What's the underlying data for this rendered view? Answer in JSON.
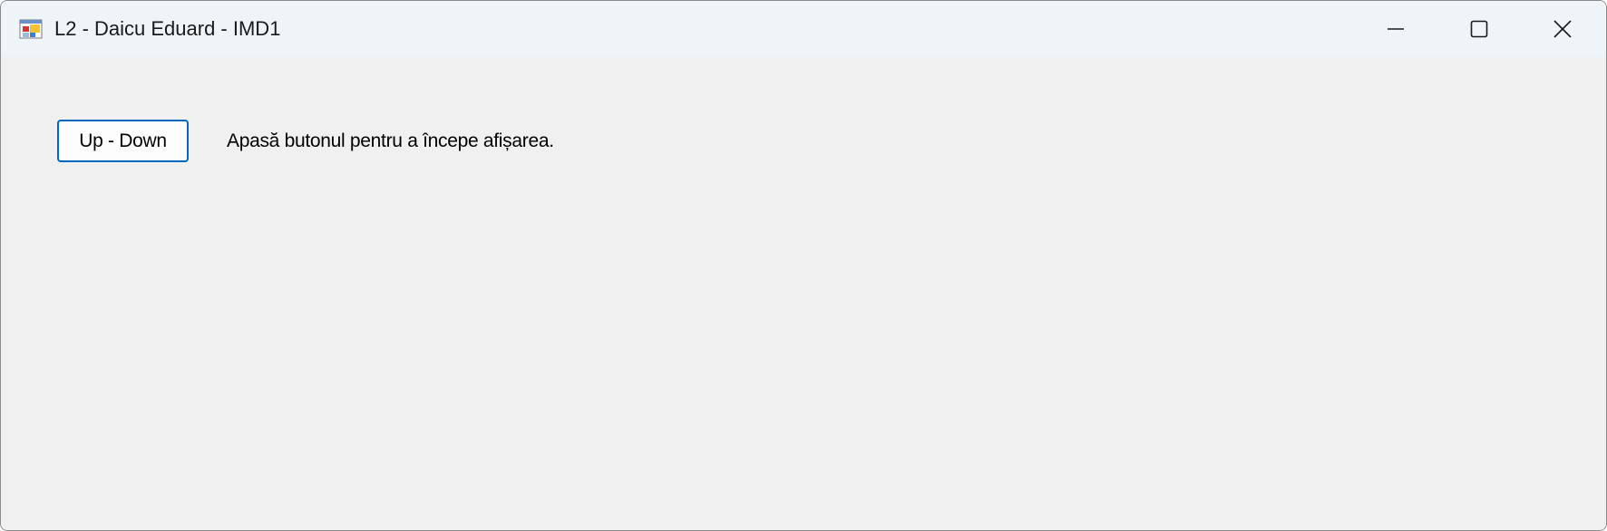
{
  "window": {
    "title": "L2 - Daicu Eduard - IMD1",
    "icon": "winforms-app-icon",
    "controls": {
      "minimize": "minimize-icon",
      "maximize": "maximize-icon",
      "close": "close-icon"
    }
  },
  "main": {
    "button_label": "Up - Down",
    "status_text": "Apasă butonul pentru a începe afișarea."
  },
  "colors": {
    "titlebar": "#eff4f9",
    "client": "#f0f0f0",
    "button_border": "#0067c0"
  }
}
